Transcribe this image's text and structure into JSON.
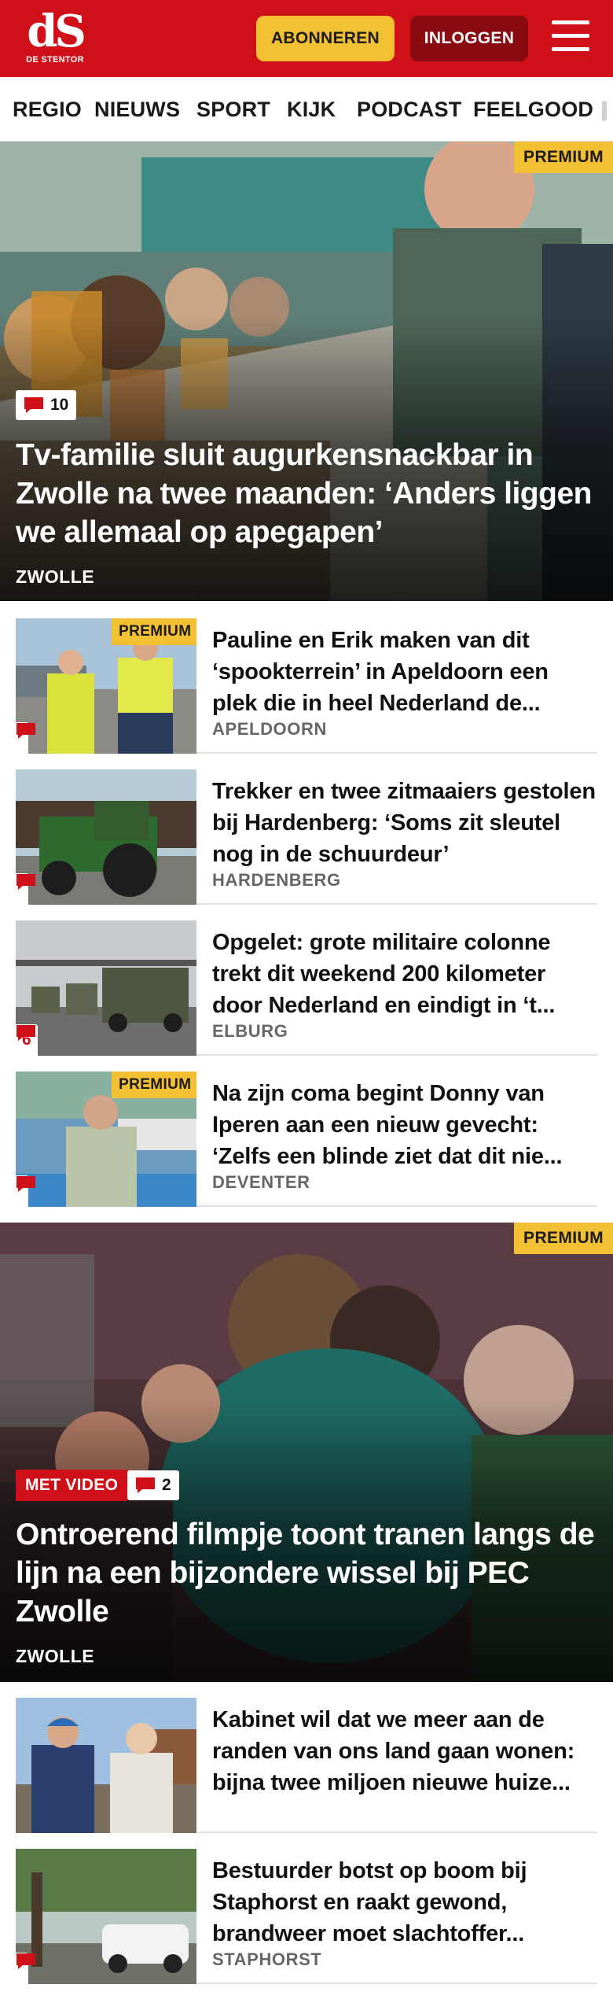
{
  "header": {
    "logo_mark": "dS",
    "logo_name": "DE STENTOR",
    "subscribe_label": "ABONNEREN",
    "login_label": "INLOGGEN"
  },
  "nav": {
    "items": [
      "REGIO",
      "NIEUWS",
      "SPORT",
      "KIJK",
      "PODCAST",
      "FEELGOOD"
    ]
  },
  "colors": {
    "brand_red": "#d01018",
    "premium_yellow": "#f4c033",
    "login_dark_red": "#8a0c12"
  },
  "icons": [
    "menu-icon",
    "comment-icon"
  ],
  "hero1": {
    "premium": "PREMIUM",
    "comments": "10",
    "title": "Tv-familie sluit augurkensnackbar in Zwolle na twee maanden: ‘Anders liggen we allemaal op apegapen’",
    "location": "ZWOLLE"
  },
  "articles": [
    {
      "premium": "PREMIUM",
      "title": "Pauline en Erik maken van dit ‘spookterrein’ in Apeldoorn een plek die in heel Nederland de...",
      "location": "APELDOORN",
      "comments": ""
    },
    {
      "title": "Trekker en twee zitmaaiers gestolen bij Hardenberg: ‘Soms zit sleutel nog in de schuurdeur’",
      "location": "HARDENBERG",
      "comments": ""
    },
    {
      "title": "Opgelet: grote militaire colonne trekt dit weekend 200 kilometer door Nederland en eindigt in ‘t...",
      "location": "ELBURG",
      "comments": "6"
    },
    {
      "premium": "PREMIUM",
      "title": "Na zijn coma begint Donny van Iperen aan een nieuw gevecht: ‘Zelfs een blinde ziet dat dit nie...",
      "location": "DEVENTER",
      "comments": ""
    }
  ],
  "hero2": {
    "premium": "PREMIUM",
    "video_tag": "MET VIDEO",
    "comments": "2",
    "title": "Ontroerend filmpje toont tranen langs de lijn na een bijzondere wissel bij PEC Zwolle",
    "location": "ZWOLLE"
  },
  "articles2": [
    {
      "title": "Kabinet wil dat we meer aan de randen van ons land gaan wonen: bijna twee miljoen nieuwe huize..."
    },
    {
      "title": "Bestuurder botst op boom bij Staphorst en raakt gewond, brandweer moet slachtoffer...",
      "location": "STAPHORST",
      "comments": ""
    }
  ]
}
